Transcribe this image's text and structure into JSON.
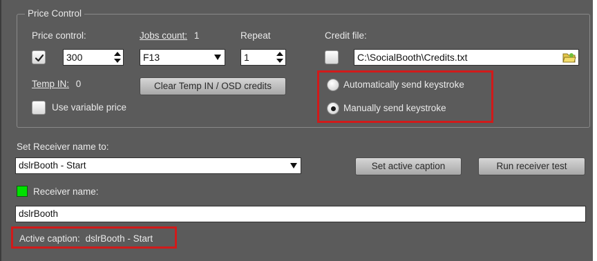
{
  "price_control": {
    "group_title": "Price Control",
    "price_control_label": "Price control:",
    "price_control_checked": true,
    "price_value": "300",
    "jobs_count_label": "Jobs count:",
    "jobs_count_value": "1",
    "jobs_key": "F13",
    "repeat_label": "Repeat",
    "repeat_value": "1",
    "credit_file_label": "Credit file:",
    "credit_file_checked": false,
    "credit_file_path": "C:\\SocialBooth\\Credits.txt",
    "temp_in_label": "Temp IN:",
    "temp_in_value": "0",
    "clear_button_label": "Clear Temp IN / OSD credits",
    "use_variable_price_label": "Use variable price",
    "use_variable_price_checked": false,
    "auto_keystroke_label": "Automatically send keystroke",
    "manual_keystroke_label": "Manually send keystroke",
    "selected_keystroke_mode": "manual"
  },
  "receiver": {
    "set_name_label": "Set Receiver name to:",
    "set_name_value": "dslrBooth - Start",
    "set_active_caption_button": "Set active caption",
    "run_receiver_test_button": "Run receiver test",
    "receiver_name_label": "Receiver name:",
    "receiver_name_value": "dslrBooth",
    "status_indicator_color": "#00e000",
    "active_caption_label": "Active caption:",
    "active_caption_value": "dslrBooth - Start"
  },
  "colors": {
    "panel_bg": "#5b5b5b",
    "highlight_red": "#d11a1a"
  },
  "icons": {
    "browse": "folder-icon",
    "check": "checkmark-icon"
  }
}
